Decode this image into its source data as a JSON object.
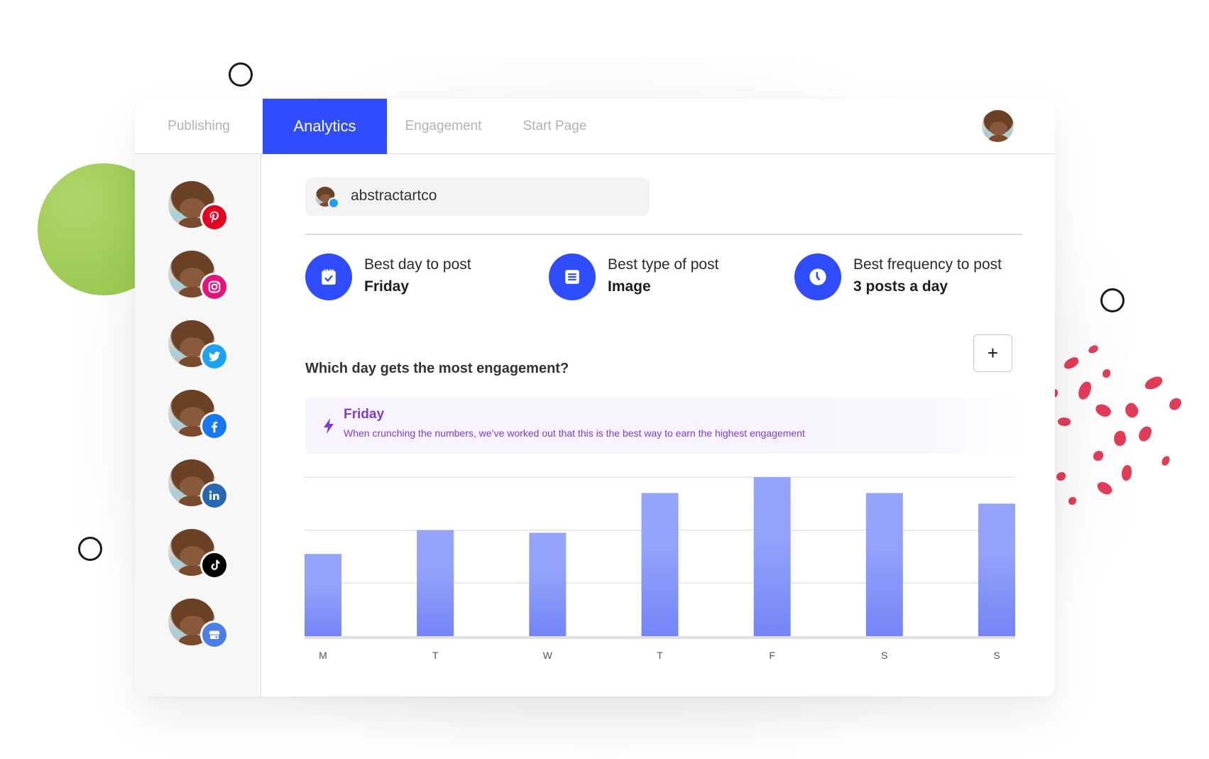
{
  "nav": {
    "tabs": [
      {
        "label": "Publishing",
        "active": false
      },
      {
        "label": "Analytics",
        "active": true
      },
      {
        "label": "Engagement",
        "active": false
      },
      {
        "label": "Start Page",
        "active": false
      }
    ]
  },
  "sidebar": {
    "channels": [
      {
        "network": "pinterest",
        "icon": "pinterest-icon",
        "color": "#e60023"
      },
      {
        "network": "instagram",
        "icon": "instagram-icon",
        "color": "#e4157a"
      },
      {
        "network": "twitter",
        "icon": "twitter-icon",
        "color": "#1da1f2"
      },
      {
        "network": "facebook",
        "icon": "facebook-icon",
        "color": "#1877f2"
      },
      {
        "network": "linkedin",
        "icon": "linkedin-icon",
        "color": "#2867b2"
      },
      {
        "network": "tiktok",
        "icon": "tiktok-icon",
        "color": "#000000"
      },
      {
        "network": "google-business",
        "icon": "storefront-icon",
        "color": "#4a7ee8"
      }
    ]
  },
  "account": {
    "name": "abstractartco",
    "network": "twitter"
  },
  "stats": [
    {
      "label": "Best day to post",
      "value": "Friday",
      "icon": "calendar-check-icon"
    },
    {
      "label": "Best type of post",
      "value": "Image",
      "icon": "document-icon"
    },
    {
      "label": "Best frequency to post",
      "value": "3 posts a day",
      "icon": "clock-icon"
    }
  ],
  "engagement": {
    "question": "Which day gets the most engagement?",
    "add_label": "+",
    "insight_title": "Friday",
    "insight_text": "When crunching the numbers, we’ve worked out that this is the best way to earn the highest engagement"
  },
  "colors": {
    "accent": "#2f4cff",
    "bar_top": "#95a4fa",
    "bar_bottom": "#7385f7",
    "insight_text": "#7d3fc7"
  },
  "chart_data": {
    "type": "bar",
    "title": "Which day gets the most engagement?",
    "categories": [
      "M",
      "T",
      "W",
      "T",
      "F",
      "S",
      "S"
    ],
    "values": [
      1.55,
      2.0,
      1.95,
      2.7,
      3.0,
      2.7,
      2.5
    ],
    "xlabel": "",
    "ylabel": "",
    "ylim": [
      0,
      3
    ],
    "grid": true,
    "gridlines": 3,
    "legend": "none"
  }
}
